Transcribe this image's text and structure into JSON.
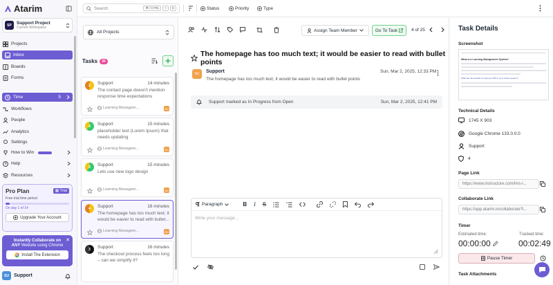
{
  "app": {
    "name": "Atarim"
  },
  "workspace": {
    "avatar": "SP",
    "name": "Support Project",
    "subtitle": "Current Workspace"
  },
  "sidebar": {
    "items": [
      {
        "label": "Projects"
      },
      {
        "label": "Inbox"
      },
      {
        "label": "Boards"
      },
      {
        "label": "Forms"
      },
      {
        "label": "Time",
        "count": "5"
      },
      {
        "label": "Workflows"
      },
      {
        "label": "People"
      },
      {
        "label": "Analytics"
      },
      {
        "label": "Settings"
      },
      {
        "label": "How to Win"
      },
      {
        "label": "Help"
      },
      {
        "label": "Resources"
      }
    ]
  },
  "pro_plan": {
    "title": "Pro Plan",
    "badge": "Trial",
    "subtitle": "Free trial time period",
    "progress": 0.07,
    "day_text": "On day 1 of 14",
    "button": "Upgrade Your Account"
  },
  "promo": {
    "line1": "Instantly Collaborate on",
    "line2_em": "ANY",
    "line2_rest": " Website using Chrome",
    "button": "Install The Extension"
  },
  "user": {
    "avatar": "SU",
    "name": "Support"
  },
  "topbar": {
    "search_placeholder": "Search",
    "kbd": [
      "⌘ / CTRL",
      "+",
      "K"
    ],
    "filters": [
      "Status",
      "Priority",
      "Type"
    ]
  },
  "project_filter": {
    "label": "All Projects"
  },
  "tasks": {
    "title": "Tasks",
    "count": "30",
    "items": [
      {
        "num": "2",
        "who": "Support",
        "time": "14 minutes",
        "text": "The contact page doesn't mention response time expectations",
        "project": "Learning Managem...",
        "av": "SU"
      },
      {
        "num": "4",
        "who": "Support",
        "time": "15 minutes",
        "text": "placeholder text (Lorem Ipsum) that needs updating",
        "project": "Learning Managem...",
        "av": "SU"
      },
      {
        "num": "5",
        "who": "Support",
        "time": "15 minutes",
        "text": "Lets use new logo design",
        "project": "Learning Managem...",
        "av": "SU"
      },
      {
        "num": "4",
        "who": "Support",
        "time": "16 minutes",
        "text": "The homepage has too much text; it would be easier to read with bullet...",
        "project": "Learning Managem...",
        "av": "SU"
      },
      {
        "num": "3",
        "who": "Support",
        "time": "16 minutes",
        "text": "The checkout process feels too long – can we simplify it?",
        "project": "",
        "av": ""
      }
    ]
  },
  "main": {
    "assign_label": "Assign Team Member",
    "goto_label": "Go To Task",
    "position": "4 of 25",
    "title": "The homepage has too much text; it would be easier to read with bullet points",
    "comment": {
      "avatar": "SU",
      "author": "Support",
      "date": "Sun, Mar 2, 2025, 12:33 PM",
      "text": "The homepage has too much text; it would be easier to read with bullet points"
    },
    "activity": {
      "text": "Support marked as In Progress from Open",
      "date": "Sun, Mar 2, 2025, 12:41 PM"
    },
    "editor": {
      "style": "Paragraph",
      "placeholder": "Write your message..."
    }
  },
  "details": {
    "title": "Task Details",
    "screenshot_label": "Screenshot",
    "screenshot_text": {
      "heading": "What is a Learning Management System?",
      "subheading": "What are the benefits of using an LMS in your school system?"
    },
    "tech_label": "Technical Details",
    "resolution": "1745 X 903",
    "browser": "Google Chrome 133.0.0.0",
    "user": "Support",
    "id": "4",
    "page_link_label": "Page Link",
    "page_link": "https://www.instructure.com/lms-l...",
    "collab_link_label": "Collaborate Link",
    "collab_link": "https://app.atarim.io/collaborate?i...",
    "timer_label": "Timer",
    "estimated_label": "Estimated time:",
    "estimated": "00:00:00",
    "tracked_label": "Tracked time:",
    "tracked": "00:02:49",
    "pause_label": "Pause Timer",
    "attachments_label": "Task Attachments"
  },
  "colors": {
    "accent": "#6c5dd3",
    "green": "#6ed08a"
  }
}
